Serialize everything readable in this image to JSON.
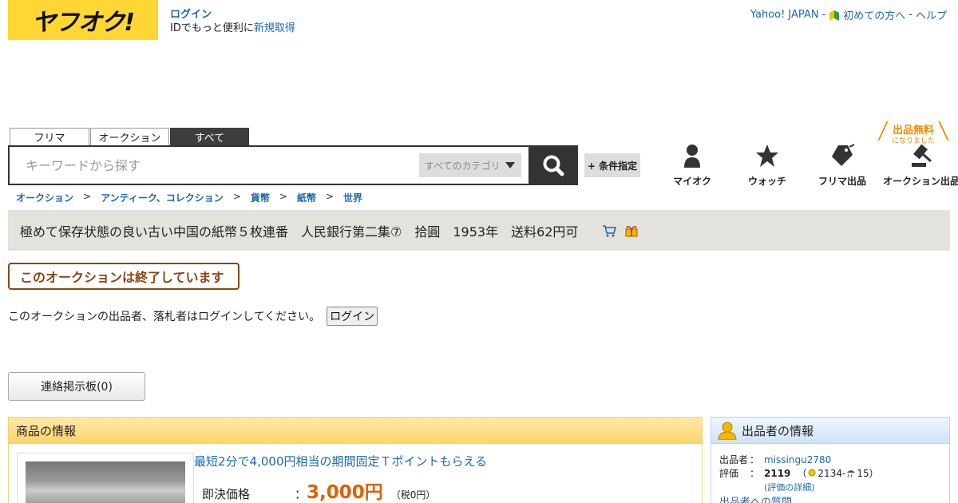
{
  "header": {
    "logo_text": "ヤフオク!",
    "login_label": "ログイン",
    "login_sub": "IDでもっと便利に",
    "signup_label": "新規取得",
    "top_links": [
      {
        "label": "Yahoo! JAPAN"
      },
      {
        "label": "初めての方へ"
      },
      {
        "label": "ヘルプ"
      }
    ],
    "sep": "-"
  },
  "search": {
    "tabs": [
      "フリマ",
      "オークション",
      "すべて"
    ],
    "active_tab": "すべて",
    "placeholder": "キーワードから探す",
    "category": "すべてのカテゴリ",
    "conditions_label": "+ 条件指定"
  },
  "nav": {
    "items": [
      {
        "label": "マイオク",
        "icon": "person-icon"
      },
      {
        "label": "ウォッチ",
        "icon": "star-icon"
      },
      {
        "label": "フリマ出品",
        "icon": "tag-icon"
      },
      {
        "label": "オークション出品",
        "icon": "gavel-icon"
      }
    ],
    "free_badge": "出品無料",
    "free_badge_sub": "になりました"
  },
  "breadcrumb": [
    "オークション",
    "アンティーク、コレクション",
    "貨幣",
    "紙幣",
    "世界"
  ],
  "breadcrumb_sep": ">",
  "item": {
    "title": "極めて保存状態の良い古い中国の紙幣５枚連番　人民銀行第二集⑦　拾圓　1953年　送料62円可",
    "ended_label": "このオークションは終了しています",
    "login_message": "このオークションの出品者、落札者はログインしてください。",
    "login_button": "ログイン",
    "board_button": "連絡掲示板(0)"
  },
  "product_panel": {
    "header": "商品の情報",
    "tpoint": "最短2分で4,000円相当の期間固定Ｔポイントもらえる",
    "price_label": "即決価格",
    "colon": "：",
    "price": "3,000円",
    "tax": "（税0円）"
  },
  "seller_panel": {
    "header": "出品者の情報",
    "seller_label": "出品者",
    "seller_name": "missingu2780",
    "rating_label": "評価",
    "rating_total": "2119",
    "rating_good": "2134",
    "rating_bad": "15",
    "rating_detail": "(評価の詳細)",
    "next_link": "出品者への質問",
    "colon": "："
  },
  "colors": {
    "yellow": "#ffd633",
    "link": "#1d68b0",
    "price": "#e06000",
    "ended": "#8b4513"
  }
}
